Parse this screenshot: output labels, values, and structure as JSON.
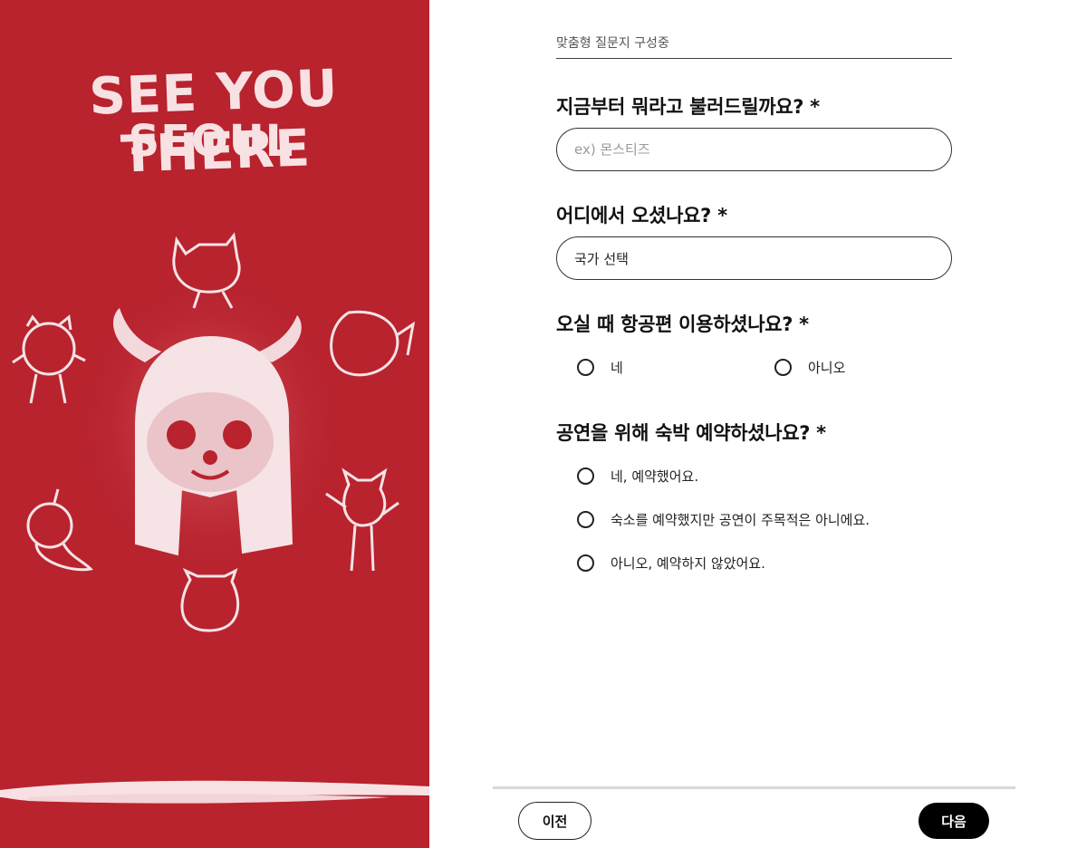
{
  "poster": {
    "title_line1": "SEE YOU THERE",
    "title_line2": "SEOUL",
    "background_color": "#b8232e",
    "ink_color": "#f7e1e3"
  },
  "form": {
    "status": "맞춤형 질문지 구성중",
    "questions": {
      "nickname": {
        "label": "지금부터 뭐라고 불러드릴까요? *",
        "placeholder": "ex) 몬스티즈"
      },
      "country": {
        "label": "어디에서 오셨나요? *",
        "selected": "국가 선택"
      },
      "flight": {
        "label": "오실 때 항공편 이용하셨나요? *",
        "options": [
          "네",
          "아니오"
        ]
      },
      "lodging": {
        "label": "공연을 위해 숙박 예약하셨나요? *",
        "options": [
          "네, 예약했어요.",
          "숙소를 예약했지만 공연이 주목적은 아니에요.",
          "아니오, 예약하지 않았어요."
        ]
      }
    }
  },
  "footer": {
    "prev_label": "이전",
    "next_label": "다음"
  }
}
